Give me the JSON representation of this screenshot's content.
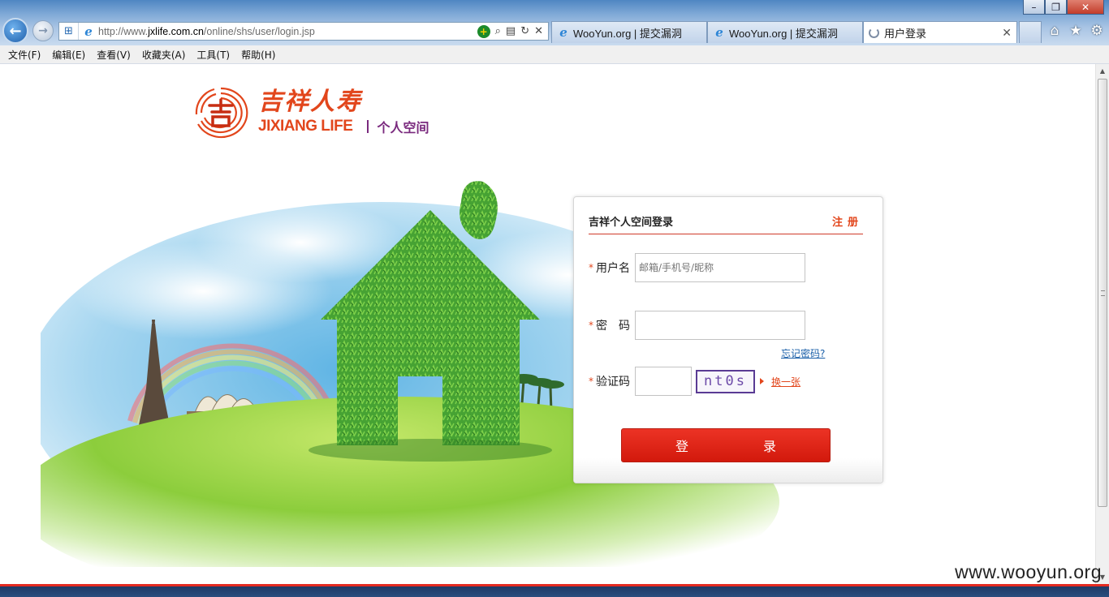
{
  "browser": {
    "address_url_prefix": "http://www.",
    "address_url_domain": "jxlife.com.cn",
    "address_url_path": "/online/shs/user/login.jsp",
    "tabs": [
      {
        "label": "WooYun.org | 提交漏洞"
      },
      {
        "label": "WooYun.org | 提交漏洞"
      },
      {
        "label": "用户登录"
      }
    ],
    "menu": [
      "文件(F)",
      "编辑(E)",
      "查看(V)",
      "收藏夹(A)",
      "工具(T)",
      "帮助(H)"
    ],
    "icons": [
      "back-arrow-icon",
      "forward-arrow-icon",
      "add-icon",
      "ie-icon",
      "compat-icon",
      "search-icon",
      "refresh-icon",
      "close-icon",
      "home-icon",
      "star-icon",
      "gear-icon"
    ]
  },
  "logo": {
    "cn": "吉祥人寿",
    "en": "JIXIANG LIFE",
    "section": "个人空间"
  },
  "login": {
    "title": "吉祥个人空间登录",
    "register": "注册",
    "required_mark": "*",
    "username_label": "用户名",
    "username_placeholder": "邮箱/手机号/昵称",
    "password_label": "密　码",
    "forgot_password": "忘记密码?",
    "captcha_label": "验证码",
    "captcha_text": "nt0s",
    "captcha_refresh": "换一张",
    "submit": "登　录"
  },
  "watermark": "www.wooyun.org",
  "colors": {
    "brand_red": "#e2461c",
    "brand_purple": "#7a2a7e",
    "button_red": "#d2190c",
    "link_blue": "#1a5fa8"
  }
}
